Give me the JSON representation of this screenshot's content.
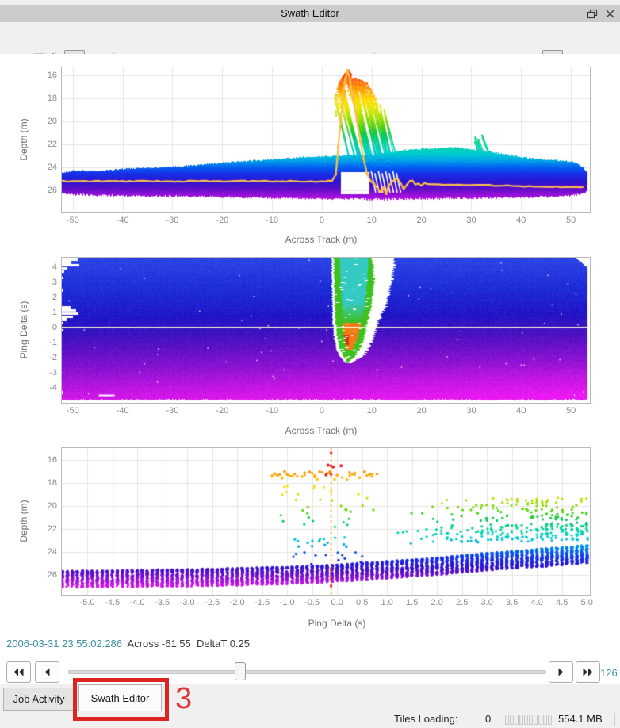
{
  "window": {
    "title": "Swath Editor"
  },
  "toolbar": {
    "buttons": [
      "save",
      "home",
      "pointer-select",
      "zoom",
      "erase",
      "rectangle-select",
      "lasso-select",
      "polygon-select",
      "undo",
      "redo",
      "point-size",
      "point-colormap",
      "subset-point-size",
      "subset-colormap",
      "reject-swath",
      "beam-filter",
      "swath-view-toggle",
      "beam-view-options",
      "display-options"
    ],
    "disabled": [
      "save",
      "undo",
      "redo"
    ],
    "active": [
      "pointer-select",
      "swath-view-toggle"
    ]
  },
  "readout": {
    "timestamp": "2006-03-31 23:55:02.286",
    "across_label": "Across",
    "across_value": "-61.55",
    "delta_label": "DeltaT",
    "delta_value": "0.25"
  },
  "transport": {
    "count": "126"
  },
  "tabs": [
    {
      "label": "Job Activity",
      "active": false
    },
    {
      "label": "Swath Editor",
      "active": true
    }
  ],
  "annotation": {
    "number": "3",
    "color": "#de2323"
  },
  "statusbar": {
    "tiles_label": "Tiles Loading:",
    "tiles_value": "0",
    "memory": "554.1 MB",
    "segments": 10
  },
  "colors": {
    "accent_teal": "#3d8fa8",
    "annotation_red": "#de2323",
    "titlebar": "#cccccc",
    "window_bg": "#f0f0f0",
    "panel_bg": "#ffffff",
    "grid": "#e4e4e4",
    "ping_line": "#ffc04a"
  },
  "depth_colormap": [
    [
      15.4,
      "#e81400"
    ],
    [
      16.3,
      "#ff5a00"
    ],
    [
      17.2,
      "#ff9c00"
    ],
    [
      18.0,
      "#ffd800"
    ],
    [
      18.8,
      "#e8e800"
    ],
    [
      19.6,
      "#a8e000"
    ],
    [
      20.4,
      "#55d300"
    ],
    [
      21.2,
      "#00c850"
    ],
    [
      22.0,
      "#00d49e"
    ],
    [
      22.8,
      "#00cdd2"
    ],
    [
      23.4,
      "#00a2e8"
    ],
    [
      23.9,
      "#0066f2"
    ],
    [
      24.5,
      "#1632e8"
    ],
    [
      25.2,
      "#2a14d2"
    ],
    [
      25.8,
      "#5c0ec8"
    ],
    [
      26.3,
      "#8e10d6"
    ],
    [
      26.8,
      "#c214e4"
    ],
    [
      27.4,
      "#f018ee"
    ]
  ],
  "chart_data": [
    {
      "type": "scatter",
      "render": "swath_profile",
      "xlabel": "Across Track (m)",
      "ylabel": "Depth (m)",
      "xlim": [
        -52.2,
        53.8
      ],
      "depth_lim": [
        15.31,
        27.86
      ],
      "xticks": [
        -50,
        -40,
        -30,
        -20,
        -10,
        0,
        10,
        20,
        30,
        40,
        50
      ],
      "yticks": [
        16,
        18,
        20,
        22,
        24,
        26
      ],
      "extent": [
        -52.7,
        53.4
      ],
      "band_top": [
        [
          -53,
          24.5
        ],
        [
          -50,
          24.3
        ],
        [
          -45,
          24.3
        ],
        [
          -40,
          24.15
        ],
        [
          -35,
          24.05
        ],
        [
          -30,
          23.95
        ],
        [
          -25,
          23.8
        ],
        [
          -20,
          23.6
        ],
        [
          -15,
          23.45
        ],
        [
          -10,
          23.3
        ],
        [
          -5,
          23.15
        ],
        [
          0,
          23.05
        ],
        [
          5,
          22.95
        ],
        [
          10,
          22.9
        ],
        [
          14,
          22.7
        ],
        [
          16,
          22.55
        ],
        [
          18,
          22.45
        ],
        [
          20,
          22.4
        ],
        [
          23,
          22.33
        ],
        [
          27,
          22.27
        ],
        [
          30,
          22.45
        ],
        [
          33,
          22.6
        ],
        [
          35,
          22.75
        ],
        [
          38,
          22.95
        ],
        [
          40,
          23.1
        ],
        [
          43,
          23.25
        ],
        [
          46,
          23.35
        ],
        [
          49,
          23.45
        ],
        [
          51,
          23.6
        ],
        [
          52.5,
          24.0
        ],
        [
          53.4,
          24.6
        ]
      ],
      "band_bottom": [
        [
          -53,
          26.25
        ],
        [
          -48,
          26.35
        ],
        [
          -40,
          26.45
        ],
        [
          -30,
          26.5
        ],
        [
          -20,
          26.55
        ],
        [
          -10,
          26.65
        ],
        [
          0,
          26.7
        ],
        [
          10,
          26.75
        ],
        [
          20,
          26.7
        ],
        [
          30,
          26.65
        ],
        [
          40,
          26.6
        ],
        [
          48,
          26.5
        ],
        [
          51,
          26.35
        ],
        [
          53.4,
          26.1
        ]
      ],
      "spike": {
        "x_range": [
          2.2,
          13.4
        ],
        "top_profile": [
          [
            2.2,
            18.3
          ],
          [
            2.8,
            17.3
          ],
          [
            3.6,
            16.4
          ],
          [
            4.4,
            15.9
          ],
          [
            5.2,
            15.45
          ],
          [
            6.0,
            16.05
          ],
          [
            7.0,
            16.3
          ],
          [
            8.0,
            16.45
          ],
          [
            9.0,
            16.65
          ],
          [
            10.0,
            17.4
          ],
          [
            11.0,
            18.2
          ],
          [
            12.0,
            18.7
          ],
          [
            13.4,
            19.2
          ]
        ],
        "streaks": 60,
        "slope": 0.55
      },
      "gap": {
        "x": [
          3.9,
          9.6
        ],
        "depth": [
          24.35,
          26.3
        ]
      },
      "white_slashes": {
        "x_start": 9.9,
        "count": 8,
        "dx": 0.72,
        "depth": [
          24.3,
          26.2
        ]
      },
      "secondary_peak": {
        "x": [
          30.6,
          32.2
        ],
        "top": 21.05,
        "streaks": 12
      },
      "ping_profile": {
        "base_depth": 25.2,
        "spike_path": [
          [
            2.8,
            24.6
          ],
          [
            3.3,
            22.2
          ],
          [
            3.8,
            19.8
          ],
          [
            4.3,
            17.6
          ],
          [
            4.8,
            16.2
          ],
          [
            5.2,
            15.55
          ],
          [
            5.7,
            16.6
          ],
          [
            6.3,
            18.1
          ],
          [
            7.0,
            19.9
          ],
          [
            7.7,
            21.7
          ],
          [
            8.4,
            23.3
          ],
          [
            9.1,
            24.6
          ],
          [
            9.8,
            25.2
          ],
          [
            10.5,
            25.45
          ],
          [
            11.2,
            25.85
          ],
          [
            11.9,
            26.15
          ],
          [
            12.4,
            25.75
          ],
          [
            12.9,
            26.3
          ],
          [
            13.4,
            25.6
          ]
        ],
        "wiggle": [
          [
            14.0,
            25.3
          ],
          [
            14.6,
            25.05
          ],
          [
            15.2,
            25.0
          ],
          [
            15.8,
            25.35
          ],
          [
            16.4,
            25.9
          ],
          [
            17.0,
            25.55
          ],
          [
            17.6,
            25.2
          ],
          [
            18.2,
            25.15
          ],
          [
            18.8,
            25.5
          ],
          [
            19.4,
            25.4
          ],
          [
            20.0,
            25.6
          ],
          [
            20.6,
            25.35
          ]
        ],
        "right_start": 25.45,
        "right_end": 25.75
      }
    },
    {
      "type": "heatmap",
      "render": "waterfall",
      "xlabel": "Across Track (m)",
      "ylabel": "Ping Delta (s)",
      "xlim": [
        -52.2,
        53.8
      ],
      "pd_lim": [
        4.63,
        -5.0
      ],
      "xticks": [
        -50,
        -40,
        -30,
        -20,
        -10,
        0,
        10,
        20,
        30,
        40,
        50
      ],
      "yticks": [
        4,
        3,
        2,
        1,
        0,
        -1,
        -2,
        -3,
        -4
      ],
      "extent": [
        -52.6,
        53.2
      ],
      "bottom_cut": -4.78,
      "gradient": [
        [
          0,
          "#2b44e6"
        ],
        [
          0.22,
          "#1c2bd6"
        ],
        [
          0.4,
          "#2014c6"
        ],
        [
          0.5,
          "#3a12bf"
        ],
        [
          0.6,
          "#5c10c4"
        ],
        [
          0.74,
          "#8c12d2"
        ],
        [
          0.87,
          "#c215e2"
        ],
        [
          1,
          "#ea18f2"
        ]
      ],
      "marker_pd": 0,
      "marker_color": "#fef8cf",
      "notches": [
        [
          4.55,
          3.5
        ],
        [
          4.35,
          2.2
        ],
        [
          4.15,
          3.8
        ],
        [
          3.95,
          1.5
        ],
        [
          3.75,
          0.8
        ],
        [
          3.3,
          0.6
        ],
        [
          2.5,
          0.5
        ],
        [
          1.35,
          2.0
        ],
        [
          1.15,
          3.2
        ],
        [
          0.95,
          3.6
        ],
        [
          0.75,
          2.6
        ],
        [
          0.55,
          1.3
        ],
        [
          0.3,
          0.6
        ],
        [
          -0.15,
          0.6
        ],
        [
          -0.4,
          0.4
        ],
        [
          -1.5,
          0.35
        ],
        [
          -2.2,
          0.3
        ],
        [
          -3.1,
          0.4
        ],
        [
          -3.9,
          0.3
        ],
        [
          -4.3,
          0.5
        ]
      ],
      "white_dash": {
        "x": [
          -44.8,
          -41.6
        ],
        "pd": -4.45
      },
      "feature": {
        "rows": [
          [
            4.63,
            2.0,
            2.4,
            3.6,
            9.3,
            10.2,
            14.8
          ],
          [
            3.0,
            2.0,
            2.5,
            3.8,
            9.0,
            10.5,
            14.0
          ],
          [
            1.5,
            2.1,
            2.6,
            4.0,
            8.6,
            10.0,
            13.0
          ],
          [
            0.5,
            2.2,
            2.8,
            4.2,
            8.0,
            9.3,
            11.5
          ],
          [
            -0.5,
            2.4,
            3.0,
            4.4,
            7.2,
            8.6,
            10.5
          ],
          [
            -1.2,
            2.8,
            3.4,
            4.8,
            6.4,
            7.8,
            9.5
          ],
          [
            -1.8,
            3.4,
            4.2,
            5.2,
            5.6,
            6.8,
            8.5
          ],
          [
            -2.3,
            4.7,
            5.0,
            5.15,
            5.2,
            5.5,
            6.3
          ]
        ],
        "green": "#3ec01e",
        "cyan": "#35c9c4",
        "orange": "#f07c16",
        "red": "#e03010",
        "cyan_bottom": 1.7,
        "orange_top": 0.35,
        "orange_bottom": -1.45,
        "red_core": {
          "x": [
            3.8,
            5.4
          ],
          "pd": [
            -1.15,
            -0.45
          ]
        }
      }
    },
    {
      "type": "scatter",
      "render": "ping_scatter",
      "xlabel": "Ping Delta (s)",
      "ylabel": "Depth (m)",
      "xlim": [
        -5.51,
        5.06
      ],
      "depth_lim": [
        14.97,
        27.72
      ],
      "xticks": [
        "-5.0",
        "-4.5",
        "-4.0",
        "-3.5",
        "-3.0",
        "-2.5",
        "-2.0",
        "-1.5",
        "-1.0",
        "-0.5",
        "0.0",
        "0.5",
        "1.0",
        "1.5",
        "2.0",
        "2.5",
        "3.0",
        "3.5",
        "4.0",
        "4.5",
        "5.0"
      ],
      "yticks": [
        16,
        18,
        20,
        22,
        24,
        26
      ],
      "ping_start": -5.5,
      "ping_end": 5.0,
      "ping_step": 0.1,
      "main_top": [
        [
          -5.5,
          25.65
        ],
        [
          -3,
          25.5
        ],
        [
          -1,
          25.3
        ],
        [
          0,
          25.1
        ],
        [
          1,
          24.8
        ],
        [
          2,
          24.5
        ],
        [
          3,
          24.1
        ],
        [
          4,
          23.75
        ],
        [
          5,
          23.4
        ]
      ],
      "main_bottom": [
        [
          -5.5,
          27.1
        ],
        [
          -3,
          27.0
        ],
        [
          -1,
          26.8
        ],
        [
          0,
          26.6
        ],
        [
          1,
          26.3
        ],
        [
          2,
          26.0
        ],
        [
          3,
          25.6
        ],
        [
          4,
          25.3
        ],
        [
          5,
          25.0
        ]
      ],
      "upper_scatter": {
        "start_x": 1.0,
        "teal_depth": [
          21.8,
          23.4
        ],
        "green_depth": [
          19.5,
          21.5
        ]
      },
      "anomaly": {
        "x_range": [
          -1.3,
          0.85
        ],
        "orange_depth": [
          17.0,
          17.7
        ],
        "red_dots": [
          [
            -0.18,
            16.45
          ],
          [
            -0.08,
            16.6
          ],
          [
            0.08,
            16.5
          ],
          [
            -0.22,
            17.3
          ]
        ],
        "yellow_depth": [
          18.2,
          19.7
        ],
        "green_depth": [
          19.9,
          21.9
        ],
        "cyan_depth": [
          22.7,
          23.6
        ],
        "blue_depth": [
          23.9,
          25.1
        ]
      },
      "selected_ping": {
        "x": -0.12,
        "color": "#ff8c00",
        "red_marks": [
          15.4,
          16.5,
          17.25,
          25.5,
          26.3,
          26.95
        ]
      }
    }
  ]
}
